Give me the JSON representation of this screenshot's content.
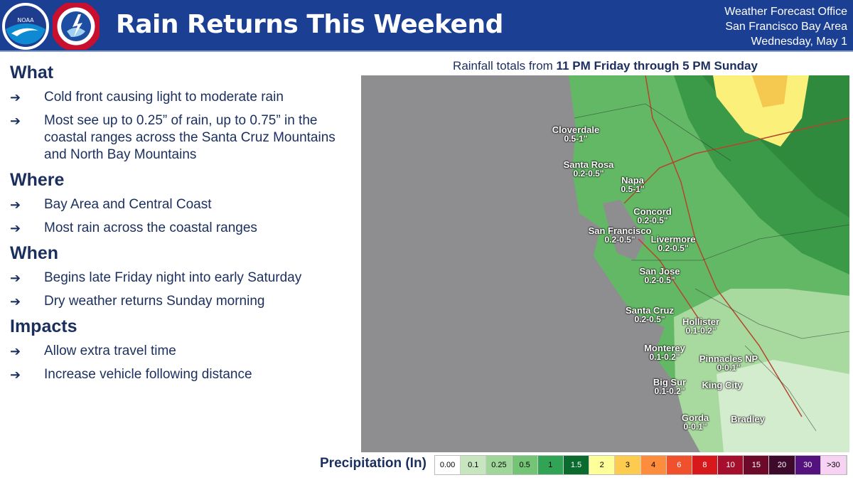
{
  "header": {
    "title": "Rain Returns This Weekend",
    "office_line1": "Weather Forecast Office",
    "office_line2": "San Francisco Bay Area",
    "date": "Wednesday, May 1",
    "logo_noaa": "NOAA",
    "logo_nws": "National Weather Service"
  },
  "sections": [
    {
      "heading": "What",
      "items": [
        "Cold front causing light to moderate rain",
        "Most see up to 0.25” of rain, up to 0.75” in the coastal ranges across the Santa Cruz Mountains and North Bay Mountains"
      ]
    },
    {
      "heading": "Where",
      "items": [
        "Bay Area and Central Coast",
        "Most rain across the coastal ranges"
      ]
    },
    {
      "heading": "When",
      "items": [
        "Begins late Friday night into early Saturday",
        "Dry weather returns Sunday morning"
      ]
    },
    {
      "heading": "Impacts",
      "items": [
        "Allow extra travel time",
        "Increase vehicle following distance"
      ]
    }
  ],
  "arrow": "➔",
  "map": {
    "title_prefix": "Rainfall totals from ",
    "title_bold": "11 PM Friday through 5 PM Sunday",
    "locations": [
      {
        "name": "Cloverdale",
        "amount": "0.5-1\""
      },
      {
        "name": "Santa Rosa",
        "amount": "0.2-0.5\""
      },
      {
        "name": "Napa",
        "amount": "0.5-1\""
      },
      {
        "name": "Concord",
        "amount": "0.2-0.5\""
      },
      {
        "name": "San Francisco",
        "amount": "0.2-0.5\""
      },
      {
        "name": "Livermore",
        "amount": "0.2-0.5\""
      },
      {
        "name": "San Jose",
        "amount": "0.2-0.5\""
      },
      {
        "name": "Santa Cruz",
        "amount": "0.2-0.5\""
      },
      {
        "name": "Hollister",
        "amount": "0.1-0.2\""
      },
      {
        "name": "Monterey",
        "amount": "0.1-0.2\""
      },
      {
        "name": "Pinnacles NP",
        "amount": "0-0.1\""
      },
      {
        "name": "Big Sur",
        "amount": "0.1-0.2\""
      },
      {
        "name": "King City",
        "amount": ""
      },
      {
        "name": "Gorda",
        "amount": "0-0.1\""
      },
      {
        "name": "Bradley",
        "amount": ""
      }
    ]
  },
  "legend": {
    "label": "Precipitation (In)",
    "bins": [
      {
        "v": "0.00",
        "c": "#ffffff",
        "t": "#000"
      },
      {
        "v": "0.1",
        "c": "#c7e6c0",
        "t": "#000"
      },
      {
        "v": "0.25",
        "c": "#a1d69a",
        "t": "#000"
      },
      {
        "v": "0.5",
        "c": "#74c476",
        "t": "#000"
      },
      {
        "v": "1",
        "c": "#31a354",
        "t": "#000"
      },
      {
        "v": "1.5",
        "c": "#0b6b2e",
        "t": "#fff"
      },
      {
        "v": "2",
        "c": "#ffff99",
        "t": "#000"
      },
      {
        "v": "3",
        "c": "#fdcb4d",
        "t": "#000"
      },
      {
        "v": "4",
        "c": "#fd8d3c",
        "t": "#000"
      },
      {
        "v": "6",
        "c": "#f0502b",
        "t": "#fff"
      },
      {
        "v": "8",
        "c": "#d7191c",
        "t": "#fff"
      },
      {
        "v": "10",
        "c": "#a50f2d",
        "t": "#fff"
      },
      {
        "v": "15",
        "c": "#6d0a2a",
        "t": "#fff"
      },
      {
        "v": "20",
        "c": "#3d0a2b",
        "t": "#fff"
      },
      {
        "v": "30",
        "c": "#54127f",
        "t": "#fff"
      },
      {
        "v": ">30",
        "c": "#f8d2f5",
        "t": "#000"
      }
    ]
  }
}
